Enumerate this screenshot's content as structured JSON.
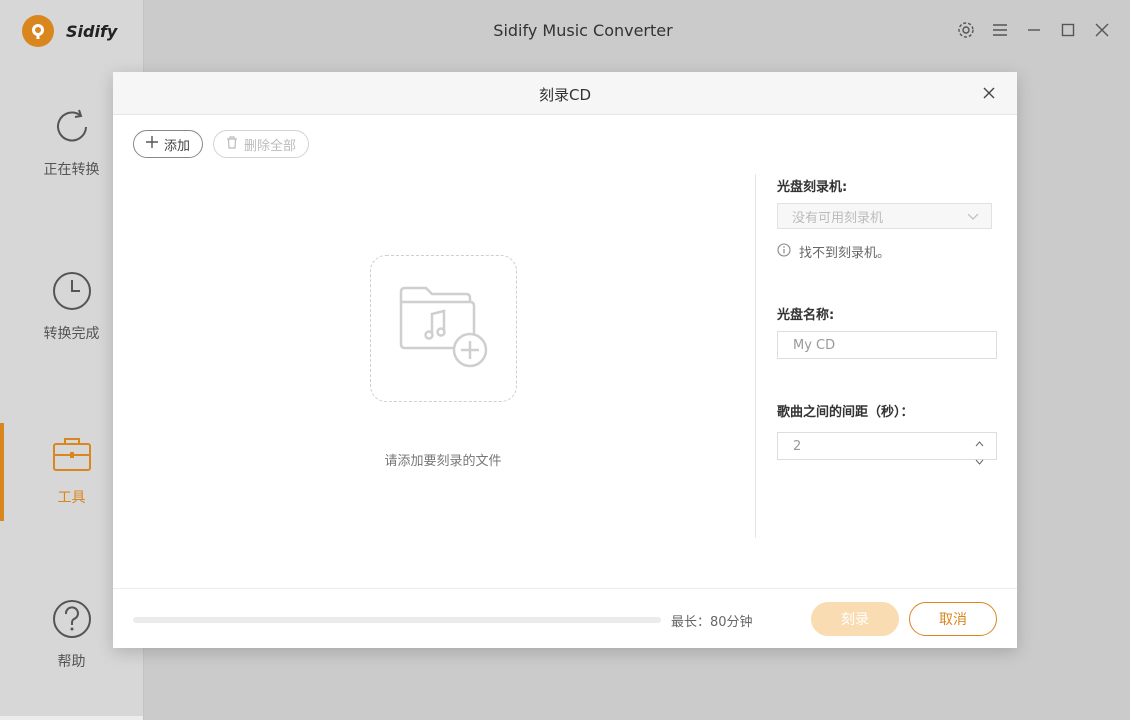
{
  "app": {
    "logo_text": "Sidify",
    "title": "Sidify Music Converter"
  },
  "sidebar": {
    "items": [
      {
        "label": "正在转换",
        "icon": "refresh-icon"
      },
      {
        "label": "转换完成",
        "icon": "clock-icon"
      },
      {
        "label": "工具",
        "icon": "toolbox-icon",
        "active": true
      },
      {
        "label": "帮助",
        "icon": "help-icon"
      }
    ]
  },
  "window_controls": [
    "gear-icon",
    "menu-icon",
    "minimize-icon",
    "maximize-icon",
    "close-icon"
  ],
  "dialog": {
    "title": "刻录CD",
    "toolbar": {
      "add_label": "添加",
      "delete_all_label": "删除全部"
    },
    "drop_hint": "请添加要刻录的文件",
    "settings": {
      "burner_label": "光盘刻录机:",
      "burner_value": "没有可用刻录机",
      "burner_note": "找不到刻录机。",
      "disc_name_label": "光盘名称:",
      "disc_name_value": "My CD",
      "gap_label": "歌曲之间的间距（秒）：",
      "gap_value": "2"
    },
    "footer": {
      "progress": 0,
      "max_length": "最长：80分钟",
      "burn_label": "刻录",
      "cancel_label": "取消"
    }
  },
  "colors": {
    "accent": "#d9861f",
    "accent_light": "#f9dcb1"
  }
}
